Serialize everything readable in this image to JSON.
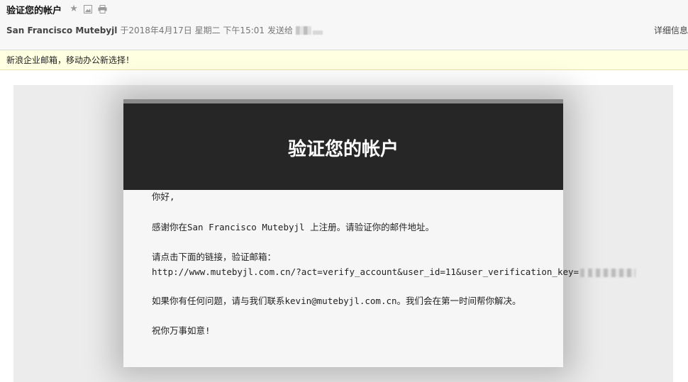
{
  "email": {
    "subject": "验证您的帐户",
    "sender": "San Francisco Mutebyjl",
    "date": "于2018年4月17日 星期二 下午15:01",
    "send_to_label": "发送给",
    "details_label": "详细信息",
    "icons": [
      "star-icon",
      "image-icon",
      "print-icon"
    ]
  },
  "banner": {
    "text": "新浪企业邮箱，移动办公新选择！"
  },
  "card": {
    "title": "验证您的帐户",
    "greeting": "你好,",
    "line_thanks": "感谢你在San Francisco Mutebyjl 上注册。请验证你的邮件地址。",
    "line_click": "请点击下面的链接，验证邮箱：",
    "url": "http://www.mutebyjl.com.cn/?act=verify_account&user_id=11&user_verification_key=",
    "line_contact": "如果你有任何问题，请与我们联系kevin@mutebyjl.com.cn。我们会在第一时间帮你解决。",
    "closing": "祝你万事如意!"
  },
  "colors": {
    "card_header_bg": "#262626",
    "banner_bg": "#ffffe1",
    "header_bg": "#f7f7f7"
  }
}
